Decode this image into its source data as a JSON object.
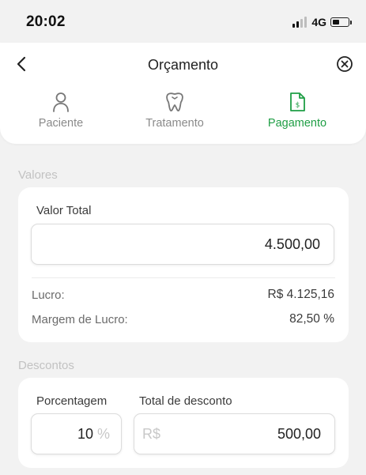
{
  "status_bar": {
    "time": "20:02",
    "network": "4G"
  },
  "header": {
    "title": "Orçamento",
    "steps": [
      {
        "label": "Paciente",
        "icon": "person-icon",
        "active": false
      },
      {
        "label": "Tratamento",
        "icon": "tooth-icon",
        "active": false
      },
      {
        "label": "Pagamento",
        "icon": "payment-document-icon",
        "active": true
      }
    ]
  },
  "valores": {
    "section_label": "Valores",
    "valor_total_label": "Valor Total",
    "valor_total_value": "4.500,00",
    "lucro_label": "Lucro:",
    "lucro_value": "R$ 4.125,16",
    "margem_label": "Margem de Lucro:",
    "margem_value": "82,50 %"
  },
  "descontos": {
    "section_label": "Descontos",
    "porcentagem_label": "Porcentagem",
    "porcentagem_value": "10",
    "porcentagem_suffix": "%",
    "total_desconto_label": "Total de desconto",
    "total_desconto_prefix": "R$",
    "total_desconto_value": "500,00"
  },
  "colors": {
    "accent_green": "#1f9e45",
    "background": "#f2f2f2",
    "card": "#ffffff",
    "inactive_text": "#8a8a8a"
  }
}
